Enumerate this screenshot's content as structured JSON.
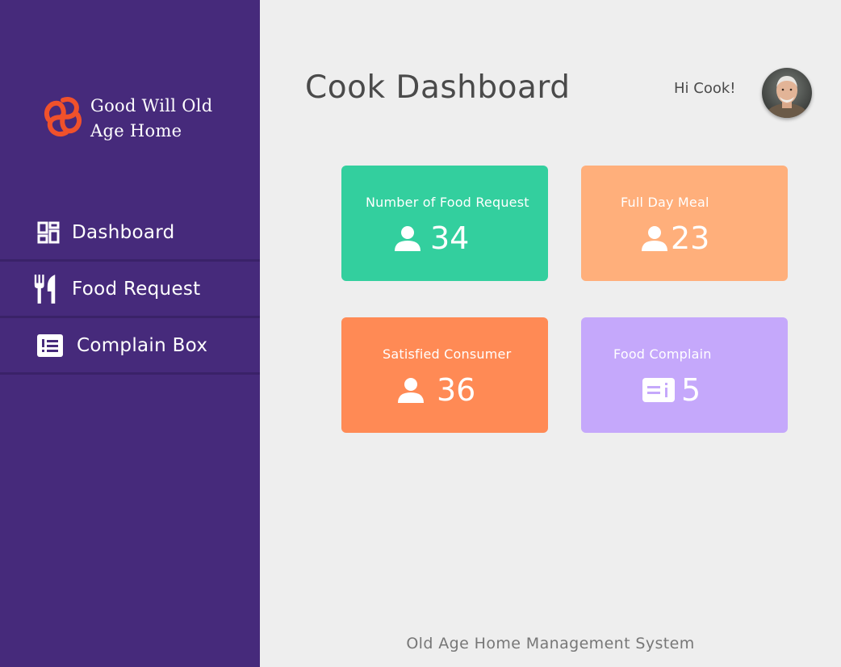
{
  "brand": {
    "name": "Good Will Old Age Home",
    "logo_icon": "flower-knot-logo",
    "logo_color": "#f0512b"
  },
  "sidebar": {
    "background": "#462a7b",
    "items": [
      {
        "label": "Dashboard",
        "icon": "dashboard-grid-icon"
      },
      {
        "label": "Food Request",
        "icon": "fork-knife-icon"
      },
      {
        "label": "Complain Box",
        "icon": "list-box-icon"
      }
    ]
  },
  "header": {
    "title": "Cook Dashboard",
    "greeting": "Hi Cook!",
    "avatar": "user-avatar"
  },
  "cards": [
    {
      "label": "Number of Food Request",
      "value": "34",
      "icon": "person-icon",
      "color": "#33cf9e"
    },
    {
      "label": "Full Day Meal",
      "value": "23",
      "icon": "person-icon",
      "color": "#ffaf7b"
    },
    {
      "label": "Satisfied Consumer",
      "value": "36",
      "icon": "person-icon",
      "color": "#ff8a55"
    },
    {
      "label": "Food Complain",
      "value": "5",
      "icon": "id-card-icon",
      "color": "#c5a8fb"
    }
  ],
  "footer": {
    "text": "Old Age Home Management System"
  }
}
